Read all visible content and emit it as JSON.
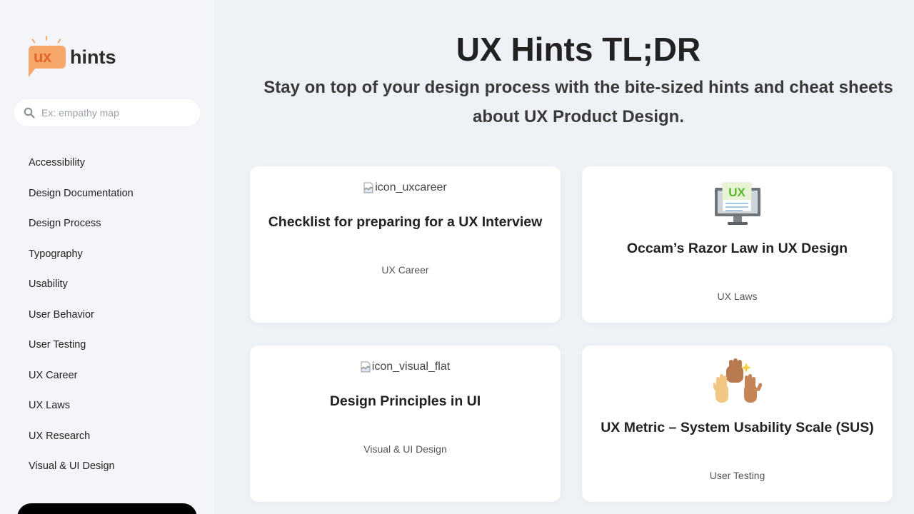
{
  "sidebar": {
    "logo": {
      "ux": "ux",
      "hints": "hints"
    },
    "search": {
      "placeholder": "Ex: empathy map"
    },
    "nav": [
      "Accessibility",
      "Design Documentation",
      "Design Process",
      "Typography",
      "Usability",
      "User Behavior",
      "User Testing",
      "UX Career",
      "UX Laws",
      "UX Research",
      "Visual & UI Design"
    ]
  },
  "main": {
    "title": "UX Hints TL;DR",
    "subtitle": "Stay on top of your design process with the bite-sized hints and cheat sheets about UX Product Design.",
    "cards": [
      {
        "image_alt": "icon_uxcareer",
        "image": "broken",
        "title": "Checklist for preparing for a UX Interview",
        "category": "UX Career"
      },
      {
        "image_label": "UX",
        "image": "monitor-icon",
        "title": "Occam’s Razor Law in UX Design",
        "category": "UX Laws"
      },
      {
        "image_alt": "icon_visual_flat",
        "image": "broken",
        "title": "Design Principles in UI",
        "category": "Visual & UI Design"
      },
      {
        "image": "raised-hands-icon",
        "title": "UX Metric – System Usability Scale (SUS)",
        "category": "User Testing"
      }
    ]
  },
  "colors": {
    "background": "#eef2f7",
    "accent": "#f6a86b",
    "brand_text": "#e3662a"
  }
}
